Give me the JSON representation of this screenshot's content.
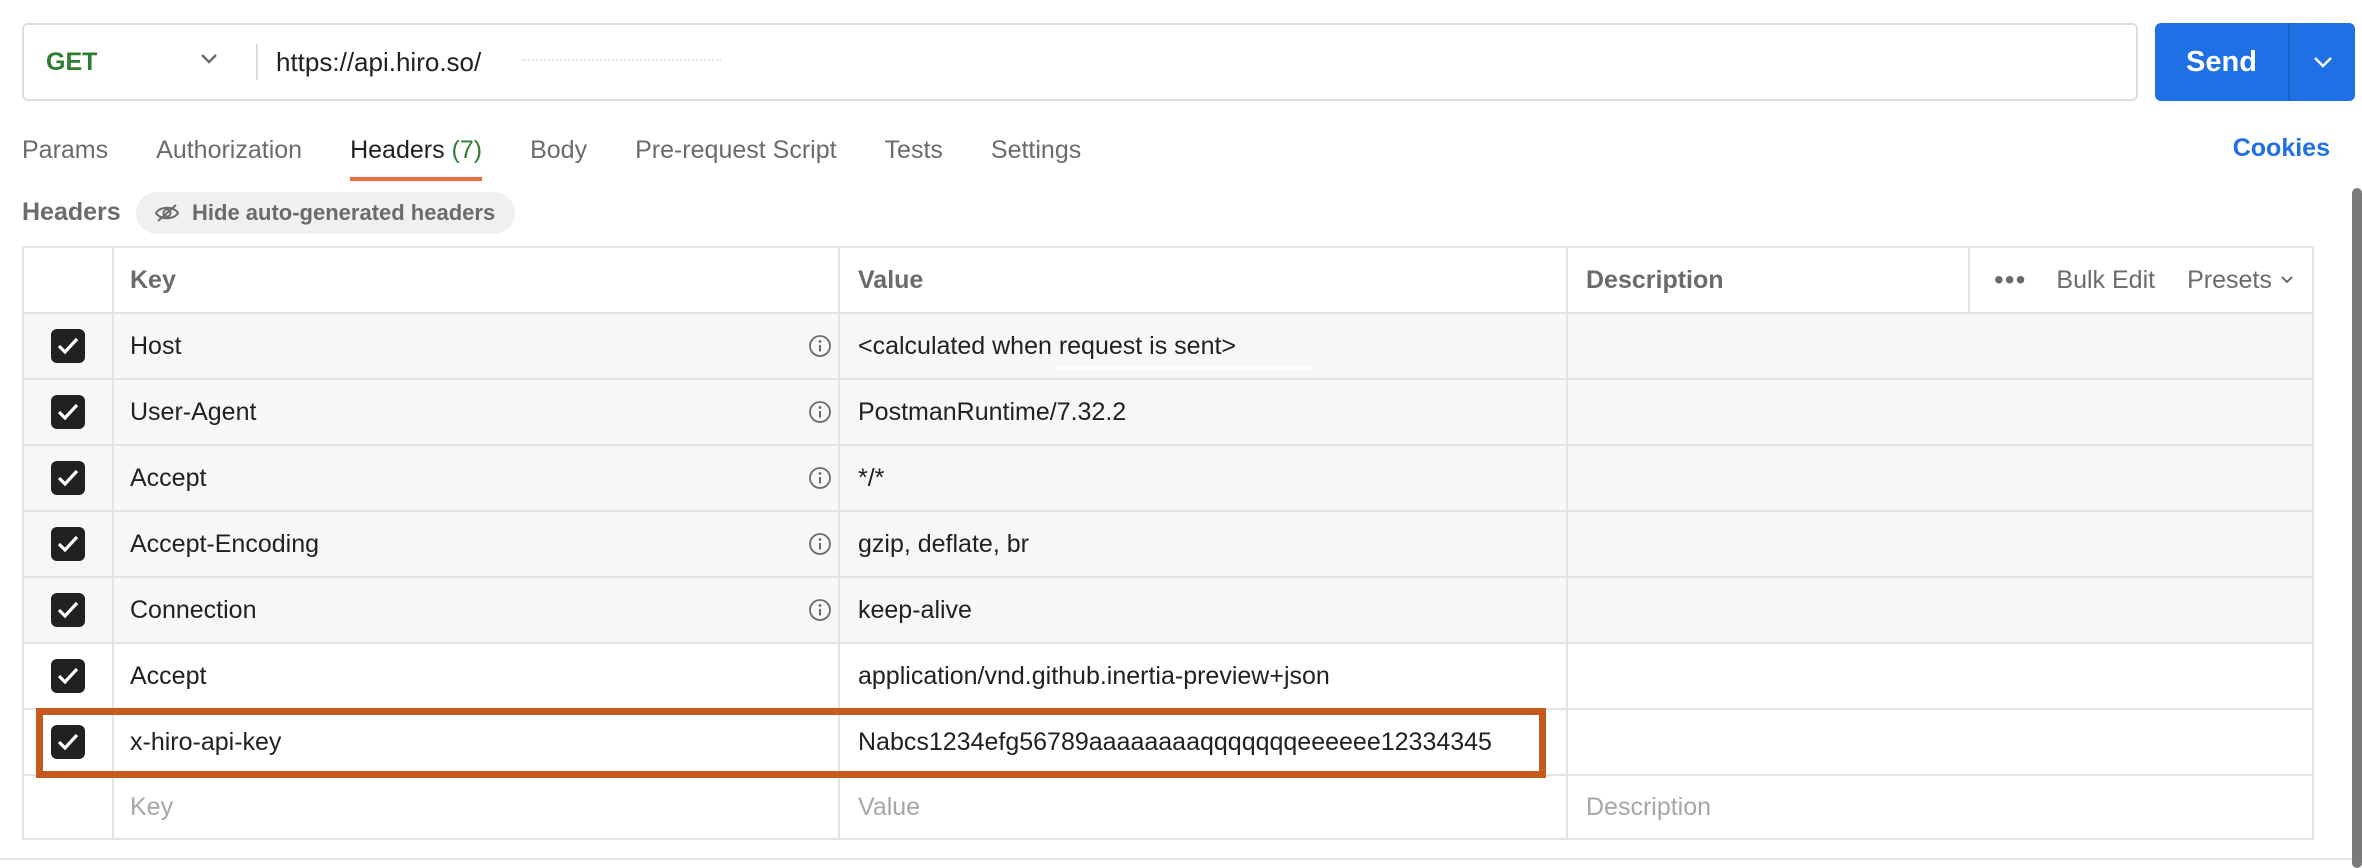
{
  "request": {
    "method": "GET",
    "url": "https://api.hiro.so/",
    "send_label": "Send"
  },
  "tabs": [
    {
      "label": "Params"
    },
    {
      "label": "Authorization"
    },
    {
      "label": "Headers",
      "count": "(7)"
    },
    {
      "label": "Body"
    },
    {
      "label": "Pre-request Script"
    },
    {
      "label": "Tests"
    },
    {
      "label": "Settings"
    }
  ],
  "cookies_label": "Cookies",
  "headers_section": {
    "title": "Headers",
    "hide_button": "Hide auto-generated headers"
  },
  "table": {
    "columns": {
      "key": "Key",
      "value": "Value",
      "description": "Description"
    },
    "tools": {
      "bulk_edit": "Bulk Edit",
      "presets": "Presets"
    },
    "rows": [
      {
        "key": "Host",
        "value": "<calculated when request is sent>",
        "checked": true,
        "auto": true
      },
      {
        "key": "User-Agent",
        "value": "PostmanRuntime/7.32.2",
        "checked": true,
        "auto": true
      },
      {
        "key": "Accept",
        "value": "*/*",
        "checked": true,
        "auto": true
      },
      {
        "key": "Accept-Encoding",
        "value": "gzip, deflate, br",
        "checked": true,
        "auto": true
      },
      {
        "key": "Connection",
        "value": "keep-alive",
        "checked": true,
        "auto": true
      },
      {
        "key": "Accept",
        "value": "application/vnd.github.inertia-preview+json",
        "checked": true,
        "auto": false
      },
      {
        "key": "x-hiro-api-key",
        "value": "Nabcs1234efg56789aaaaaaaaqqqqqqqeeeeee12334345",
        "checked": true,
        "auto": false
      }
    ],
    "new_row": {
      "key_placeholder": "Key",
      "value_placeholder": "Value",
      "description_placeholder": "Description"
    }
  },
  "colors": {
    "accent": "#1f6fe5",
    "method_get": "#2f7d32",
    "tab_underline": "#ef6f3c",
    "highlight": "#c55a1f"
  }
}
